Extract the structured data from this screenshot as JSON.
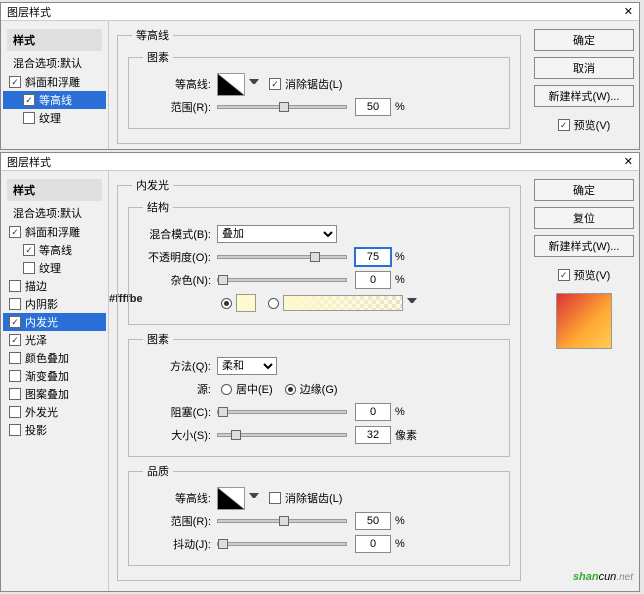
{
  "d1": {
    "title": "图层样式",
    "sidebar": {
      "head": "样式",
      "blend": "混合选项:默认",
      "items": [
        "斜面和浮雕",
        "等高线",
        "纹理"
      ]
    },
    "group": {
      "legend": "等高线",
      "sub": "图素",
      "contour": "等高线:",
      "anti": "消除锯齿(L)",
      "range": "范围(R):",
      "rangeval": "50",
      "pct": "%"
    },
    "btns": {
      "ok": "确定",
      "cancel": "取消",
      "newstyle": "新建样式(W)...",
      "preview": "预览(V)"
    }
  },
  "d2": {
    "title": "图层样式",
    "sidebar": {
      "head": "样式",
      "blend": "混合选项:默认",
      "items": [
        {
          "t": "斜面和浮雕",
          "c": true,
          "i": 0
        },
        {
          "t": "等高线",
          "c": true,
          "i": 1
        },
        {
          "t": "纹理",
          "c": false,
          "i": 1
        },
        {
          "t": "描边",
          "c": false,
          "i": 0
        },
        {
          "t": "内阴影",
          "c": false,
          "i": 0
        },
        {
          "t": "内发光",
          "c": true,
          "i": 0,
          "sel": true
        },
        {
          "t": "光泽",
          "c": true,
          "i": 0
        },
        {
          "t": "颜色叠加",
          "c": false,
          "i": 0
        },
        {
          "t": "渐变叠加",
          "c": false,
          "i": 0
        },
        {
          "t": "图案叠加",
          "c": false,
          "i": 0
        },
        {
          "t": "外发光",
          "c": false,
          "i": 0
        },
        {
          "t": "投影",
          "c": false,
          "i": 0
        }
      ]
    },
    "group": "内发光",
    "struct": {
      "legend": "结构",
      "blend": "混合模式(B):",
      "blendv": "叠加",
      "opac": "不透明度(O):",
      "opacv": "75",
      "noise": "杂色(N):",
      "noisev": "0",
      "pct": "%",
      "hex": "#ffffbe"
    },
    "elem": {
      "legend": "图素",
      "method": "方法(Q):",
      "methodv": "柔和",
      "source": "源:",
      "center": "居中(E)",
      "edge": "边缘(G)",
      "choke": "阻塞(C):",
      "chokev": "0",
      "size": "大小(S):",
      "sizev": "32",
      "px": "像素",
      "pct": "%"
    },
    "qual": {
      "legend": "品质",
      "contour": "等高线:",
      "anti": "消除锯齿(L)",
      "range": "范围(R):",
      "rangev": "50",
      "jitter": "抖动(J):",
      "jitterv": "0",
      "pct": "%"
    },
    "btns": {
      "ok": "确定",
      "cancel": "复位",
      "newstyle": "新建样式(W)...",
      "preview": "预览(V)"
    }
  },
  "watermark": {
    "a": "shan",
    "b": "cun",
    "c": ".net"
  }
}
